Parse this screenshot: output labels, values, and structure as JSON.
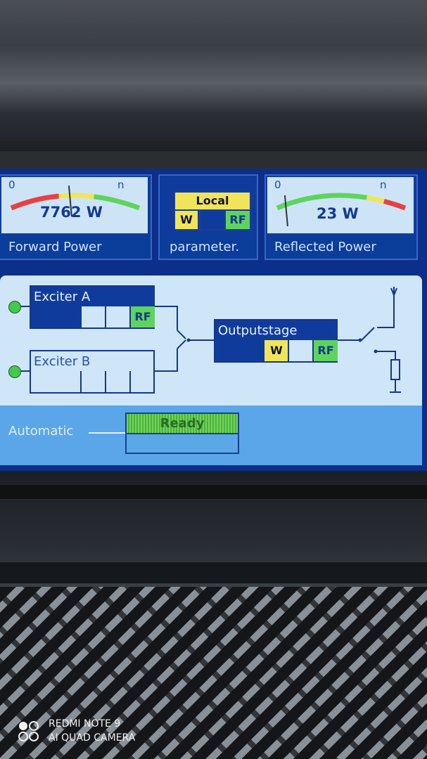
{
  "forward_power": {
    "scale_min": "0",
    "scale_max": "n",
    "value": "7762 W",
    "label": "Forward Power",
    "needle_position": 0.45
  },
  "parameter_panel": {
    "mode": "Local",
    "w": "W",
    "rf": "RF",
    "label": "parameter."
  },
  "reflected_power": {
    "scale_min": "0",
    "scale_max": "n",
    "value": "23 W",
    "label": "Reflected Power",
    "needle_position": 0.06
  },
  "diagram": {
    "exciter_a": {
      "label": "Exciter A",
      "rf": "RF",
      "status_color": "#45c94a"
    },
    "exciter_b": {
      "label": "Exciter B",
      "status_color": "#45c94a"
    },
    "outputstage": {
      "label": "Outputstage",
      "w": "W",
      "rf": "RF"
    }
  },
  "automatic": {
    "label": "Automatic",
    "state": "Ready"
  },
  "watermark": {
    "line1": "REDMI NOTE 9",
    "line2": "AI QUAD CAMERA"
  },
  "colors": {
    "screen_blue": "#0b2f8a",
    "panel_light": "#cde4f7",
    "yellow": "#f0e55a",
    "green": "#5fd35f",
    "red": "#e94040"
  }
}
